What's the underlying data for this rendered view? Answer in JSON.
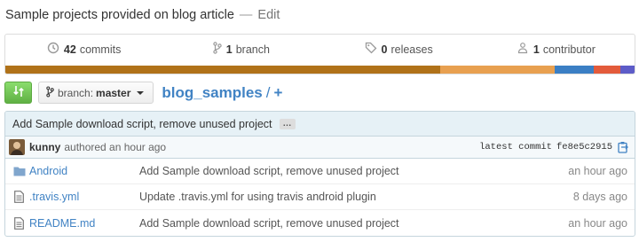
{
  "repo": {
    "description": "Sample projects provided on blog article",
    "separator": "—",
    "edit_label": "Edit"
  },
  "stats": [
    {
      "icon": "history-icon",
      "count": "42",
      "label": "commits"
    },
    {
      "icon": "branch-icon",
      "count": "1",
      "label": "branch"
    },
    {
      "icon": "tag-icon",
      "count": "0",
      "label": "releases"
    },
    {
      "icon": "organization-icon",
      "count": "1",
      "label": "contributor"
    }
  ],
  "language_bar": [
    {
      "color": "#b07219",
      "share": 0.691
    },
    {
      "color": "#e8a050",
      "share": 0.182
    },
    {
      "color": "#3b7fc4",
      "share": 0.062
    },
    {
      "color": "#e35b3b",
      "share": 0.043
    },
    {
      "color": "#5d5cc8",
      "share": 0.022
    }
  ],
  "toolbar": {
    "branch_label": "branch:",
    "branch_value": "master",
    "repo_name": "blog_samples",
    "path_sep": "/",
    "add_label": "+"
  },
  "commit": {
    "message": "Add Sample download script, remove unused project",
    "ellipsis": "…",
    "author": "kunny",
    "authored": "authored an hour ago",
    "latest_label": "latest commit",
    "sha": "fe8e5c2915"
  },
  "files": [
    {
      "icon": "folder-icon",
      "name": "Android",
      "message": "Add Sample download script, remove unused project",
      "age": "an hour ago"
    },
    {
      "icon": "file-icon",
      "name": ".travis.yml",
      "message": "Update .travis.yml for using travis android plugin",
      "age": "8 days ago"
    },
    {
      "icon": "file-icon",
      "name": "README.md",
      "message": "Add Sample download script, remove unused project",
      "age": "an hour ago"
    }
  ],
  "colors": {
    "link": "#4183c4",
    "commit_bg": "#e6f1f6",
    "compare_green": "#60b044"
  }
}
